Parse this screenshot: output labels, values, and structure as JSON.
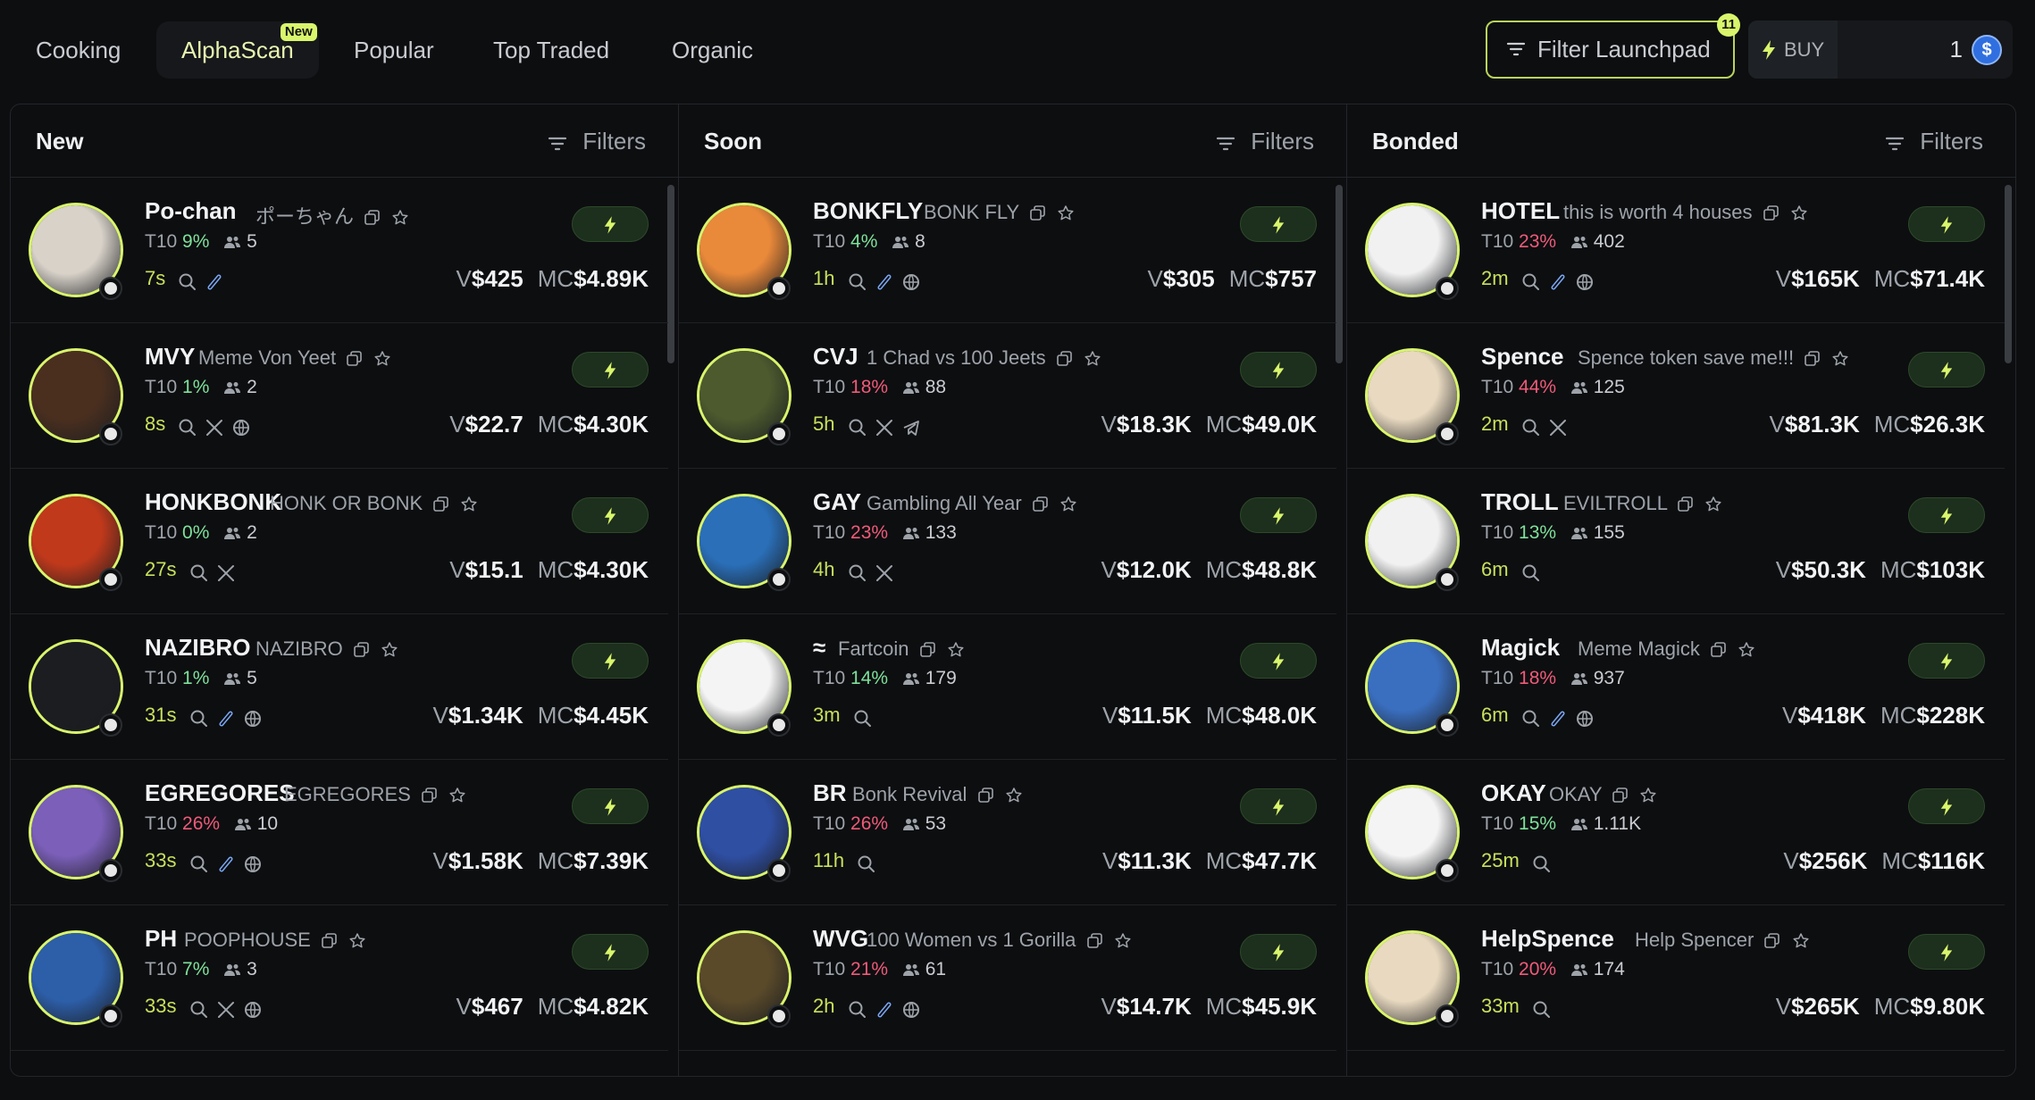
{
  "tabs": [
    {
      "label": "Cooking",
      "active": false
    },
    {
      "label": "AlphaScan",
      "active": true,
      "badge": "New"
    },
    {
      "label": "Popular",
      "active": false
    },
    {
      "label": "Top Traded",
      "active": false
    },
    {
      "label": "Organic",
      "active": false
    }
  ],
  "filter_launchpad": {
    "label": "Filter Launchpad",
    "count": "11"
  },
  "buy": {
    "label": "BUY",
    "amount": "1",
    "currency_icon": "solana-icon"
  },
  "colors": {
    "accent": "#d9f56c",
    "green": "#7ee19a",
    "red": "#ef5b7a",
    "bg": "#0d0e10"
  },
  "columns": [
    {
      "title": "New",
      "filters_label": "Filters",
      "rows": [
        {
          "ticker": "Po-chan",
          "name": "ポーちゃん",
          "t10": "9%",
          "t10_color": "green",
          "holders": "5",
          "age": "7s",
          "links": [
            "search",
            "pill"
          ],
          "v": "$425",
          "mc": "$4.89K"
        },
        {
          "ticker": "MVY",
          "name": "Meme Von Yeet",
          "t10": "1%",
          "t10_color": "green",
          "holders": "2",
          "age": "8s",
          "links": [
            "search",
            "x",
            "web"
          ],
          "v": "$22.7",
          "mc": "$4.30K"
        },
        {
          "ticker": "HONKBONK",
          "name": "HONK OR BONK",
          "t10": "0%",
          "t10_color": "green",
          "holders": "2",
          "age": "27s",
          "links": [
            "search",
            "x"
          ],
          "v": "$15.1",
          "mc": "$4.30K"
        },
        {
          "ticker": "NAZIBRO",
          "name": "NAZIBRO",
          "t10": "1%",
          "t10_color": "green",
          "holders": "5",
          "age": "31s",
          "links": [
            "search",
            "pill",
            "web"
          ],
          "v": "$1.34K",
          "mc": "$4.45K"
        },
        {
          "ticker": "EGREGORES",
          "name": "EGREGORES",
          "t10": "26%",
          "t10_color": "red",
          "holders": "10",
          "age": "33s",
          "links": [
            "search",
            "pill",
            "web"
          ],
          "v": "$1.58K",
          "mc": "$7.39K"
        },
        {
          "ticker": "PH",
          "name": "POOPHOUSE",
          "t10": "7%",
          "t10_color": "green",
          "holders": "3",
          "age": "33s",
          "links": [
            "search",
            "x",
            "web"
          ],
          "v": "$467",
          "mc": "$4.82K"
        }
      ]
    },
    {
      "title": "Soon",
      "filters_label": "Filters",
      "rows": [
        {
          "ticker": "BONKFLY",
          "name": "BONK FLY",
          "t10": "4%",
          "t10_color": "green",
          "holders": "8",
          "age": "1h",
          "links": [
            "search",
            "pill",
            "web"
          ],
          "v": "$305",
          "mc": "$757"
        },
        {
          "ticker": "CVJ",
          "name": "1 Chad vs 100 Jeets",
          "t10": "18%",
          "t10_color": "red",
          "holders": "88",
          "age": "5h",
          "links": [
            "search",
            "x",
            "telegram"
          ],
          "v": "$18.3K",
          "mc": "$49.0K"
        },
        {
          "ticker": "GAY",
          "name": "Gambling All Year",
          "t10": "23%",
          "t10_color": "red",
          "holders": "133",
          "age": "4h",
          "links": [
            "search",
            "x"
          ],
          "v": "$12.0K",
          "mc": "$48.8K"
        },
        {
          "ticker": "≈",
          "name": "Fartcoin",
          "t10": "14%",
          "t10_color": "green",
          "holders": "179",
          "age": "3m",
          "links": [
            "search"
          ],
          "v": "$11.5K",
          "mc": "$48.0K"
        },
        {
          "ticker": "BR",
          "name": "Bonk Revival",
          "t10": "26%",
          "t10_color": "red",
          "holders": "53",
          "age": "11h",
          "links": [
            "search"
          ],
          "v": "$11.3K",
          "mc": "$47.7K"
        },
        {
          "ticker": "WVG",
          "name": "100 Women vs 1 Gorilla",
          "t10": "21%",
          "t10_color": "red",
          "holders": "61",
          "age": "2h",
          "links": [
            "search",
            "pill",
            "web"
          ],
          "v": "$14.7K",
          "mc": "$45.9K"
        }
      ]
    },
    {
      "title": "Bonded",
      "filters_label": "Filters",
      "rows": [
        {
          "ticker": "HOTEL",
          "name": "this is worth 4 houses",
          "t10": "23%",
          "t10_color": "red",
          "holders": "402",
          "age": "2m",
          "links": [
            "search",
            "pill",
            "web"
          ],
          "v": "$165K",
          "mc": "$71.4K"
        },
        {
          "ticker": "Spence",
          "name": "Spence token save me!!!",
          "t10": "44%",
          "t10_color": "red",
          "holders": "125",
          "age": "2m",
          "links": [
            "search",
            "x"
          ],
          "v": "$81.3K",
          "mc": "$26.3K"
        },
        {
          "ticker": "TROLL",
          "name": "EVILTROLL",
          "t10": "13%",
          "t10_color": "green",
          "holders": "155",
          "age": "6m",
          "links": [
            "search"
          ],
          "v": "$50.3K",
          "mc": "$103K"
        },
        {
          "ticker": "Magick",
          "name": "Meme Magick",
          "t10": "18%",
          "t10_color": "red",
          "holders": "937",
          "age": "6m",
          "links": [
            "search",
            "pill",
            "web"
          ],
          "v": "$418K",
          "mc": "$228K"
        },
        {
          "ticker": "OKAY",
          "name": "OKAY",
          "t10": "15%",
          "t10_color": "green",
          "holders": "1.11K",
          "age": "25m",
          "links": [
            "search"
          ],
          "v": "$256K",
          "mc": "$116K"
        },
        {
          "ticker": "HelpSpence",
          "name": "Help Spencer",
          "t10": "20%",
          "t10_color": "red",
          "holders": "174",
          "age": "33m",
          "links": [
            "search"
          ],
          "v": "$265K",
          "mc": "$9.80K"
        }
      ]
    }
  ],
  "labels": {
    "t10": "T10",
    "v": "V",
    "mc": "MC"
  }
}
